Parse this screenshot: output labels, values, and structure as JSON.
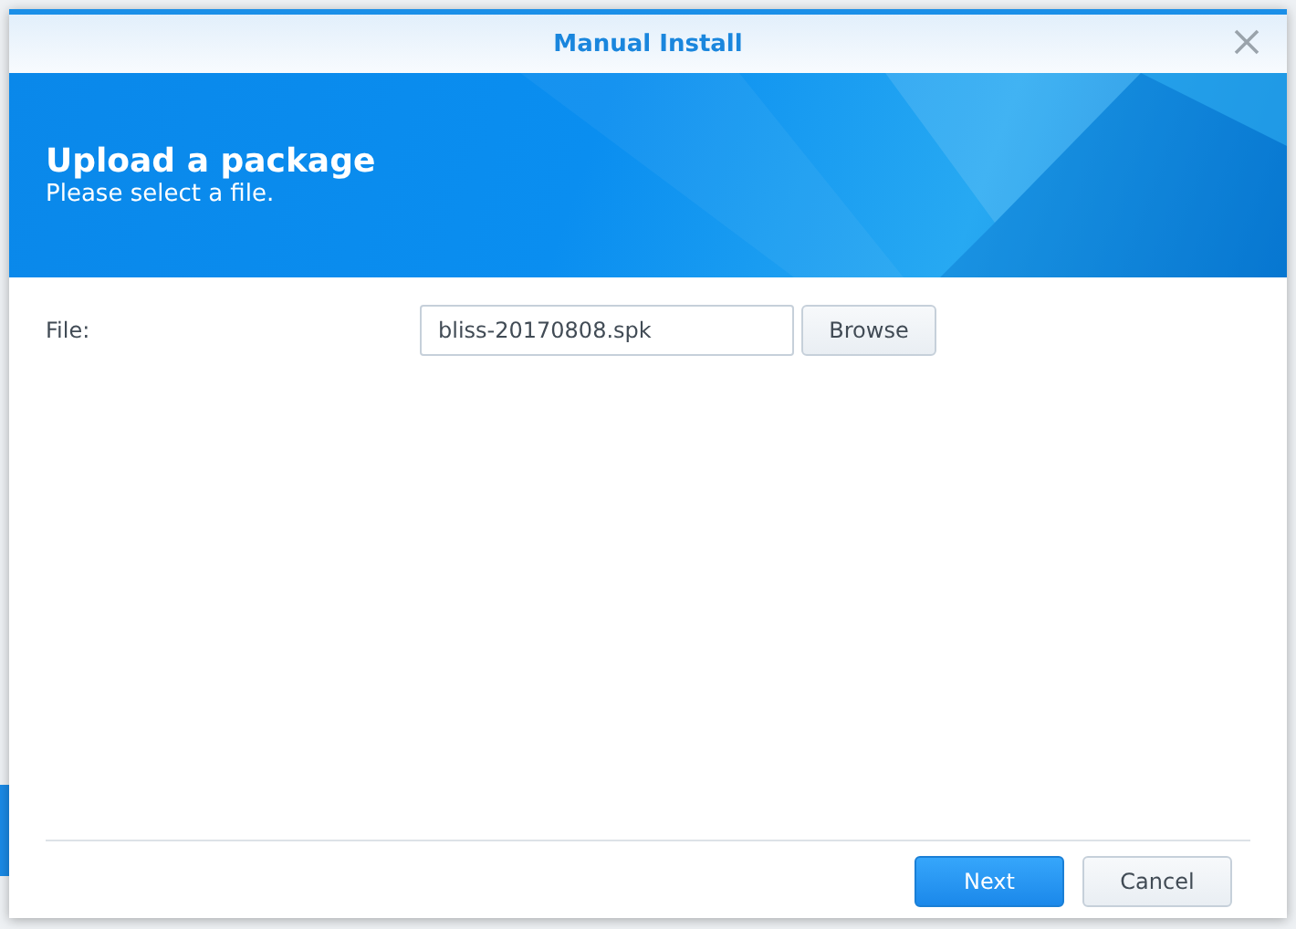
{
  "window": {
    "title": "Manual Install"
  },
  "banner": {
    "title": "Upload a package",
    "subtitle": "Please select a file."
  },
  "file_field": {
    "label": "File:",
    "value": "bliss-20170808.spk",
    "browse_label": "Browse"
  },
  "buttons": [
    {
      "label": "Next",
      "kind": "primary"
    },
    {
      "label": "Cancel",
      "kind": "secondary"
    }
  ]
}
